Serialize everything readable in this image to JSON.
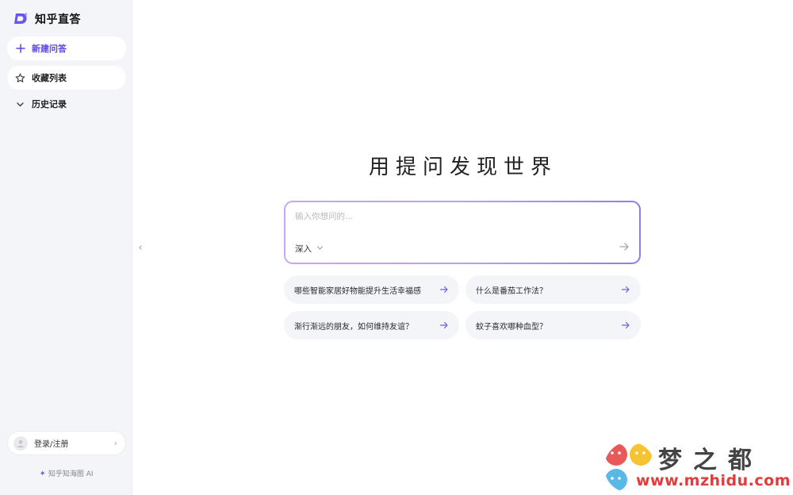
{
  "brand": {
    "name": "知乎直答",
    "logo_color": "#5b46e6"
  },
  "sidebar": {
    "new_chat": "新建问答",
    "favorites": "收藏列表",
    "history": "历史记录",
    "login": "登录/注册",
    "footer": "知乎知海图 AI"
  },
  "main": {
    "title": "用提问发现世界",
    "input_placeholder": "输入你想问的...",
    "mode": "深入",
    "suggestions": [
      "哪些智能家居好物能提升生活幸福感",
      "什么是番茄工作法？",
      "渐行渐远的朋友，如何维持友谊？",
      "蚊子喜欢哪种血型？"
    ]
  },
  "watermark": {
    "title": "梦之都",
    "url": "www.mzhidu.com"
  },
  "colors": {
    "accent": "#5b46e6",
    "sidebar_bg": "#f4f5f8",
    "chip_bg": "#f4f5f8"
  }
}
